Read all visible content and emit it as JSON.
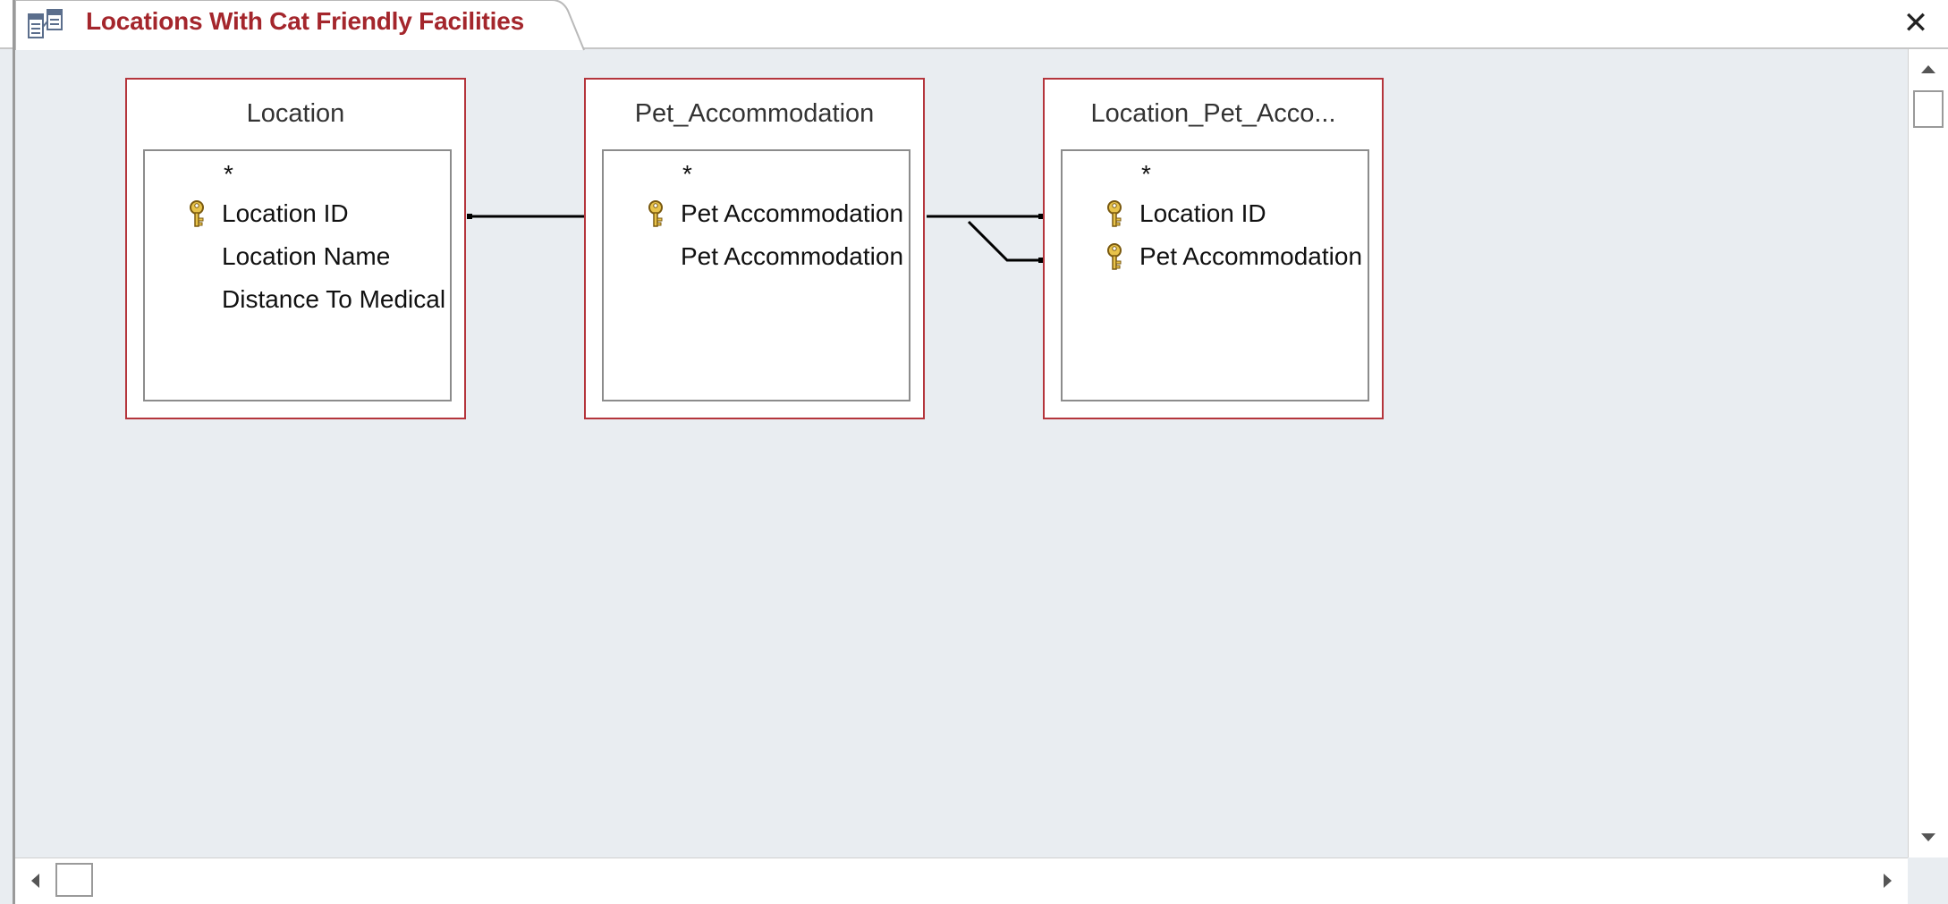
{
  "window": {
    "tab_title": "Locations With Cat Friendly Facilities",
    "close_glyph": "✕"
  },
  "icons": {
    "tab": "relationships-icon",
    "key": "primary-key-icon",
    "close": "close-icon"
  },
  "colors": {
    "accent": "#a4262c",
    "table_border": "#b4353c",
    "canvas_bg": "#e9edf1"
  },
  "tables": [
    {
      "title": "Location",
      "fields": [
        {
          "name": "*",
          "key": false
        },
        {
          "name": "Location ID",
          "key": true
        },
        {
          "name": "Location Name",
          "key": false
        },
        {
          "name": "Distance To Medical Facility",
          "key": false
        }
      ]
    },
    {
      "title": "Pet_Accommodation",
      "fields": [
        {
          "name": "*",
          "key": false
        },
        {
          "name": "Pet Accommodation ID",
          "key": true
        },
        {
          "name": "Pet Accommodation",
          "key": false
        }
      ]
    },
    {
      "title": "Location_Pet_Acco...",
      "fields": [
        {
          "name": "*",
          "key": false
        },
        {
          "name": "Location ID",
          "key": true
        },
        {
          "name": "Pet Accommodation ID",
          "key": true
        }
      ]
    }
  ]
}
